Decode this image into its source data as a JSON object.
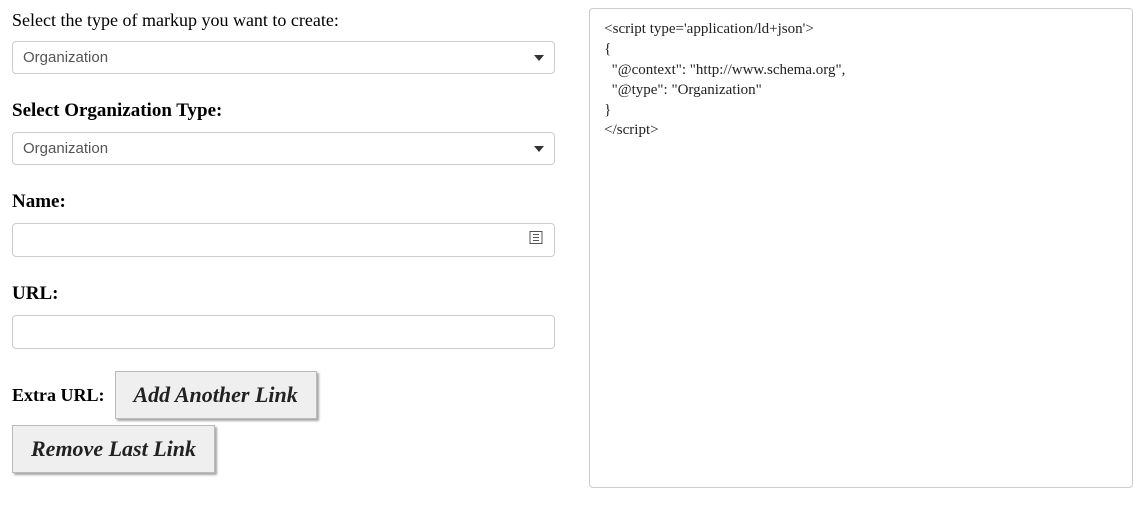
{
  "left": {
    "markupTypeLabel": "Select the type of markup you want to create:",
    "markupTypeValue": "Organization",
    "orgTypeLabel": "Select Organization Type:",
    "orgTypeValue": "Organization",
    "nameLabel": "Name:",
    "nameValue": "",
    "urlLabel": "URL:",
    "urlValue": "",
    "extraUrlLabel": "Extra URL:",
    "addAnotherLinkLabel": "Add Another Link",
    "removeLastLinkLabel": "Remove Last Link"
  },
  "output": {
    "line1": "<script type='application/ld+json'>",
    "line2": "{",
    "line3": "  \"@context\": \"http://www.schema.org\",",
    "line4": "  \"@type\": \"Organization\"",
    "line5": "}",
    "line6": "</script>"
  }
}
